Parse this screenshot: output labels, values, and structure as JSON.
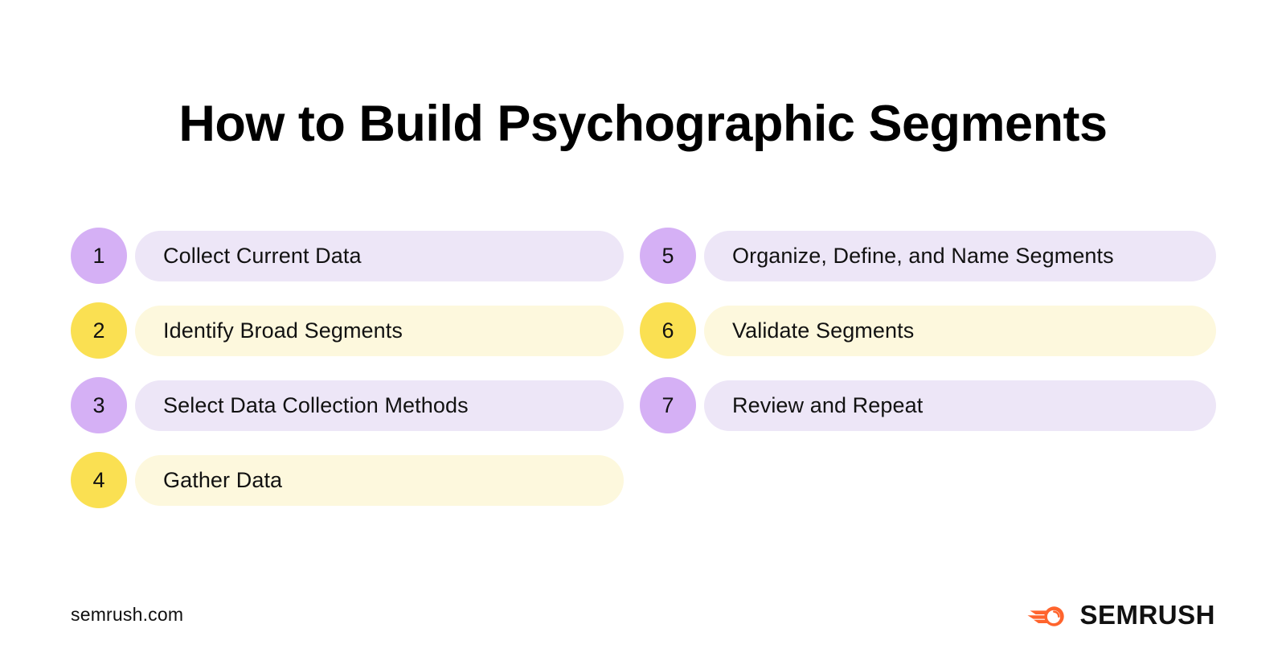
{
  "page": {
    "title": "How to Build Psychographic Segments",
    "background": "#FFFFFF"
  },
  "theme": {
    "purple_badge": "#D5B0F5",
    "purple_pill": "#EDE6F7",
    "yellow_badge": "#FAE052",
    "yellow_pill": "#FDF8DD",
    "text": "#121212",
    "brand_orange": "#FF642D"
  },
  "steps": {
    "left_column": [
      {
        "number": "1",
        "label": "Collect Current Data",
        "color": "purple"
      },
      {
        "number": "2",
        "label": "Identify Broad Segments",
        "color": "yellow"
      },
      {
        "number": "3",
        "label": "Select Data Collection Methods",
        "color": "purple"
      },
      {
        "number": "4",
        "label": "Gather Data",
        "color": "yellow"
      }
    ],
    "right_column": [
      {
        "number": "5",
        "label": "Organize, Define, and Name Segments",
        "color": "purple"
      },
      {
        "number": "6",
        "label": "Validate Segments",
        "color": "yellow"
      },
      {
        "number": "7",
        "label": "Review and Repeat",
        "color": "purple"
      }
    ]
  },
  "footer": {
    "url": "semrush.com",
    "brand_name": "SEMRUSH",
    "brand_icon": "semrush-comet-icon"
  }
}
